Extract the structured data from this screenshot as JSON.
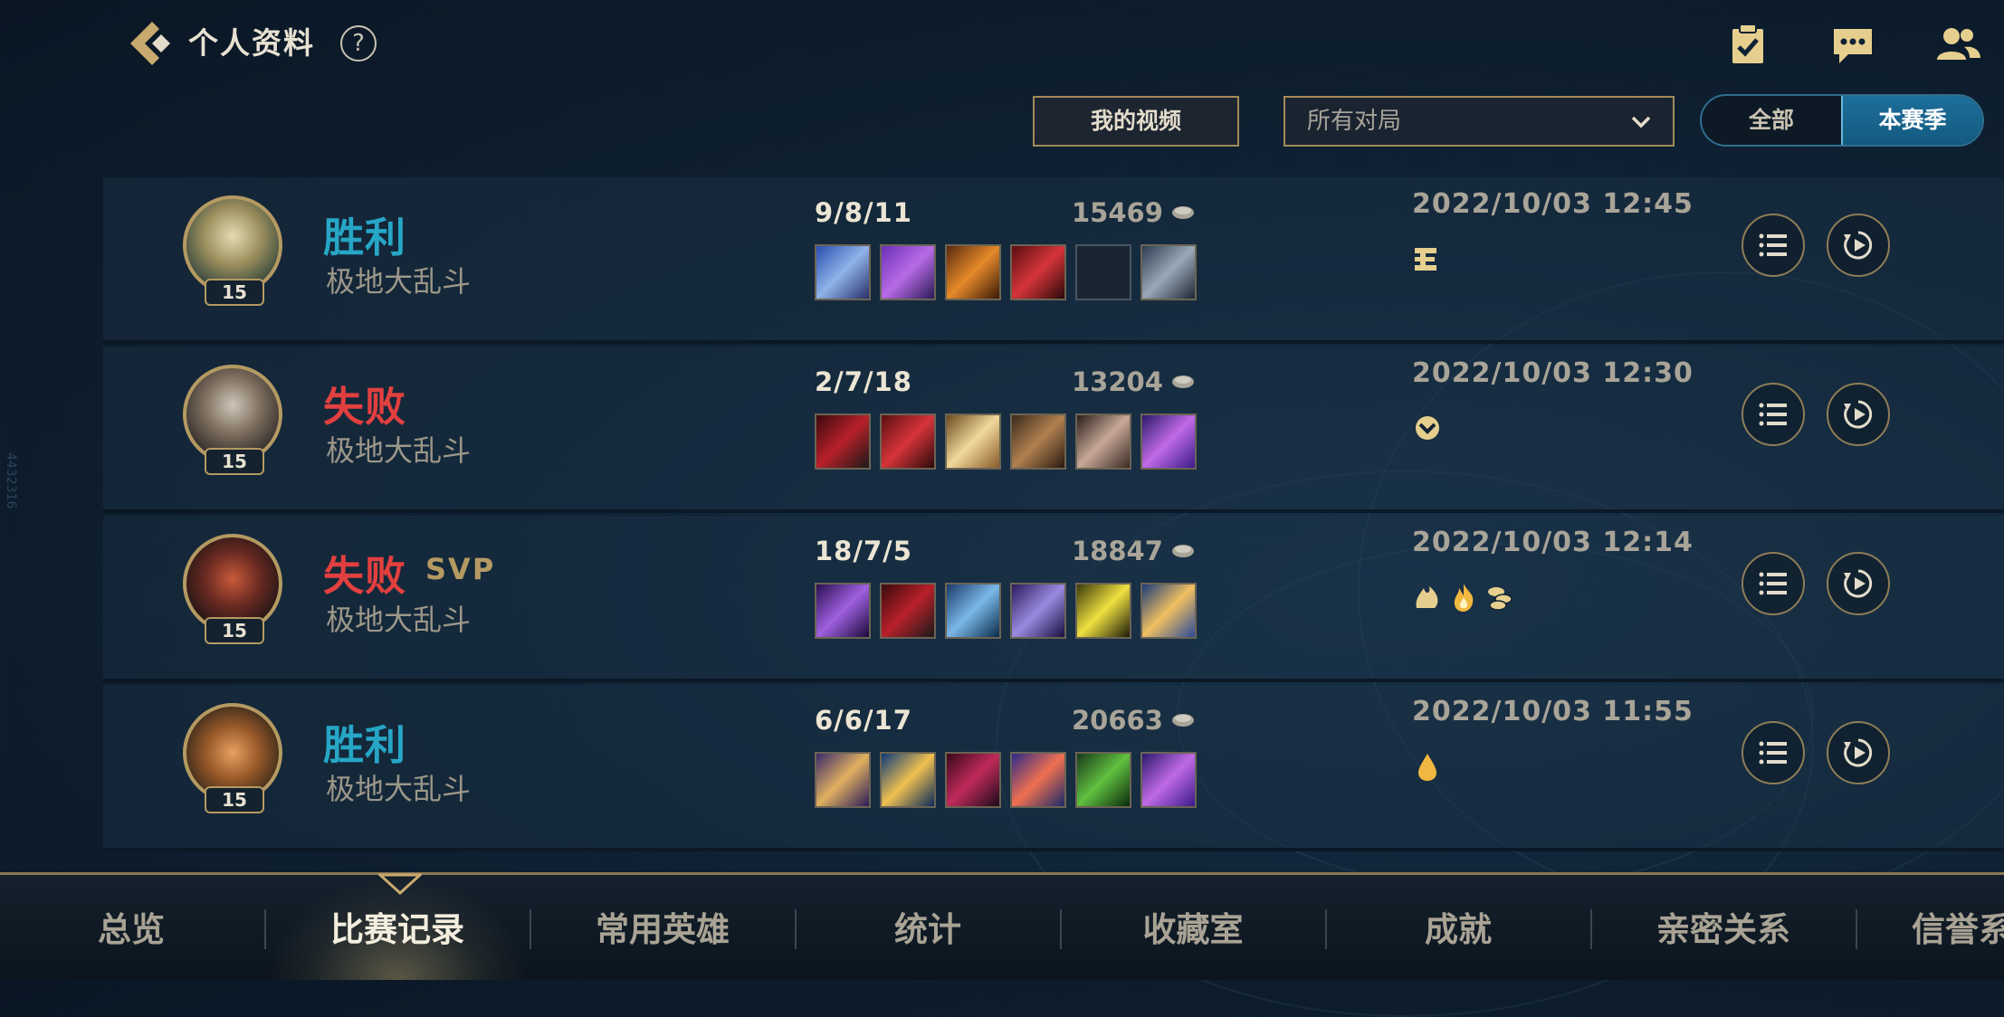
{
  "header": {
    "title": "个人资料",
    "help_glyph": "?",
    "icons": [
      "task-check-icon",
      "chat-bubble-icon",
      "friends-icon"
    ]
  },
  "filters": {
    "my_videos_label": "我的视频",
    "match_filter_value": "所有对局",
    "toggle": {
      "all_label": "全部",
      "season_label": "本赛季",
      "selected": "本赛季"
    }
  },
  "matches": [
    {
      "result": "胜利",
      "result_type": "win",
      "svp": "",
      "mode": "极地大乱斗",
      "level": "15",
      "kda": "9/8/11",
      "gold": "15469",
      "datetime": "2022/10/03 12:45",
      "items": [
        "item-ice-blade",
        "item-purple-axe",
        "item-flame-blade",
        "item-red-claw",
        "item-empty-slot",
        "item-warding-totem"
      ],
      "badges": [
        "triple-kill-badge"
      ]
    },
    {
      "result": "失败",
      "result_type": "loss",
      "svp": "",
      "mode": "极地大乱斗",
      "level": "15",
      "kda": "2/7/18",
      "gold": "13204",
      "datetime": "2022/10/03 12:30",
      "items": [
        "item-dark-blade",
        "item-red-claw",
        "item-angel-wings",
        "item-hammer",
        "item-stone-gauntlet",
        "item-purple-comet"
      ],
      "badges": [
        "assist-badge"
      ]
    },
    {
      "result": "失败",
      "result_type": "loss",
      "svp": "SVP",
      "mode": "极地大乱斗",
      "level": "15",
      "kda": "18/7/5",
      "gold": "18847",
      "datetime": "2022/10/03 12:14",
      "items": [
        "item-void-staff",
        "item-dark-blade",
        "item-bow",
        "item-spear",
        "item-shield-triangle",
        "item-hourglass"
      ],
      "badges": [
        "damage-badge",
        "fire-badge",
        "gold-badge"
      ]
    },
    {
      "result": "胜利",
      "result_type": "win",
      "svp": "",
      "mode": "极地大乱斗",
      "level": "15",
      "kda": "6/6/17",
      "gold": "20663",
      "datetime": "2022/10/03 11:55",
      "items": [
        "item-crescent-staff",
        "item-trident",
        "item-demon-mask",
        "item-target-orb",
        "item-green-claw",
        "item-purple-comet"
      ],
      "badges": [
        "drop-badge"
      ]
    }
  ],
  "bottom_nav": {
    "tabs": [
      "总览",
      "比赛记录",
      "常用英雄",
      "统计",
      "收藏室",
      "成就",
      "亲密关系",
      "信誉系"
    ],
    "active": "比赛记录"
  },
  "edge_text": "4432316",
  "colors": {
    "win": "#27a6c6",
    "loss": "#e2403f",
    "gold_accent": "#b49a62",
    "toggle_active": "#1d6f9c"
  }
}
